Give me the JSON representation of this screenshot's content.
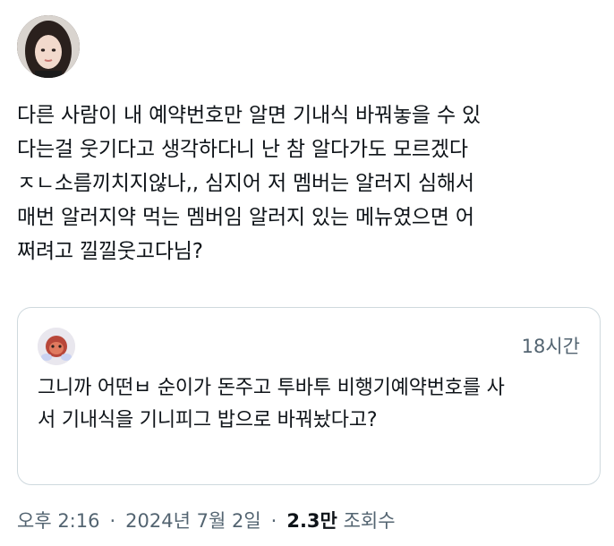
{
  "tweet": {
    "text_lines": [
      "다른 사람이 내 예약번호만 알면 기내식 바꿔놓을 수 있",
      "다는걸 웃기다고 생각하다니 난 참 알다가도 모르겠다",
      "ㅈㄴ소름끼치지않나,, 심지어 저 멤버는 알러지 심해서",
      "매번 알러지약 먹는 멤버임 알러지 있는 메뉴였으면 어",
      "쩌려고 낄낄웃고다님?"
    ],
    "avatar_icon": "profile-photo"
  },
  "quote": {
    "time": "18시간",
    "text_lines": [
      "그니까 어떤ㅂ  순이가 돈주고 투바투 비행기예약번호를 사",
      "서 기내식을 기니피그 밥으로 바꿔놨다고?"
    ],
    "avatar_icon": "profile-photo"
  },
  "meta": {
    "time": "오후 2:16",
    "date": "2024년 7월 2일",
    "views_count": "2.3만",
    "views_label": "조회수",
    "separator": "·"
  },
  "colors": {
    "text": "#0f1419",
    "secondary": "#536471",
    "border": "#cfd9de"
  }
}
